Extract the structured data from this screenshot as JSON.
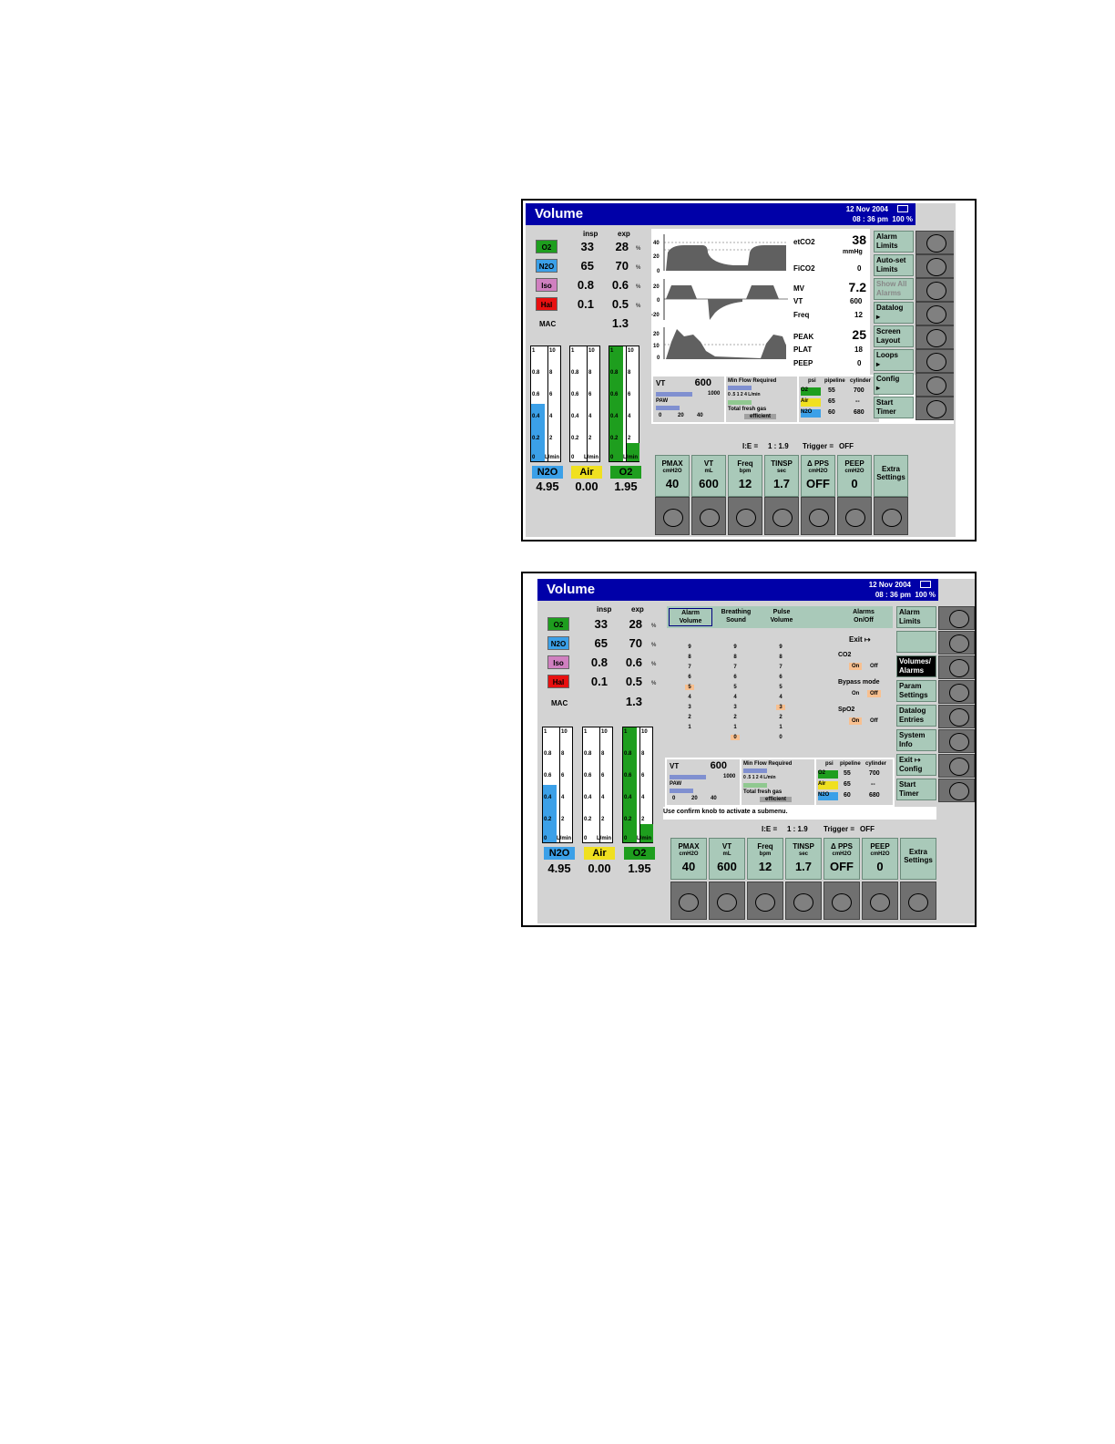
{
  "screen": {
    "title": "Volume",
    "date": "12  Nov  2004",
    "time": "08 : 36  pm",
    "battery": "100 %"
  },
  "gases": {
    "insp_header": "insp",
    "exp_header": "exp",
    "rows": [
      {
        "label": "O2",
        "insp": "33",
        "exp": "28",
        "unit": "%",
        "color": "#1e9e1e"
      },
      {
        "label": "N2O",
        "insp": "65",
        "exp": "70",
        "unit": "%",
        "color": "#3ba0e8"
      },
      {
        "label": "Iso",
        "insp": "0.8",
        "exp": "0.6",
        "unit": "%",
        "color": "#d080c0"
      },
      {
        "label": "Hal",
        "insp": "0.1",
        "exp": "0.5",
        "unit": "%",
        "color": "#e81010"
      }
    ],
    "mac_label": "MAC",
    "mac_value": "1.3"
  },
  "flowmeters": [
    {
      "name": "N2O",
      "flow": "4.95",
      "fill": 0.5,
      "color": "#3ba0e8",
      "label_color": "#3ba0e8"
    },
    {
      "name": "Air",
      "flow": "0.00",
      "fill": 0.0,
      "color": "#ffffff",
      "label_color": "#f0e020"
    },
    {
      "name": "O2",
      "flow": "1.95",
      "fill": 1.0,
      "color": "#1e9e1e",
      "label_color": "#1e9e1e"
    }
  ],
  "flow_scale_left": [
    "1",
    "0.8",
    "0.6",
    "0.4",
    "0.2",
    "0"
  ],
  "flow_scale_right": [
    "10",
    "8",
    "6",
    "4",
    "2",
    "L/min"
  ],
  "waveforms": {
    "co2_ticks": [
      "40",
      "20",
      "0"
    ],
    "flow_ticks": [
      "20",
      "0",
      "-20"
    ],
    "paw_ticks": [
      "20",
      "10",
      "0"
    ]
  },
  "vitals": {
    "etco2_label": "etCO2",
    "etco2_value": "38",
    "etco2_unit": "mmHg",
    "fico2_label": "FiCO2",
    "fico2_value": "0",
    "mv_label": "MV",
    "mv_value": "7.2",
    "vt_label": "VT",
    "vt_value": "600",
    "freq_label": "Freq",
    "freq_value": "12",
    "peak_label": "PEAK",
    "peak_value": "25",
    "plat_label": "PLAT",
    "plat_value": "18",
    "peep_label": "PEEP",
    "peep_value": "0"
  },
  "vt_box": {
    "label": "VT",
    "value": "600",
    "max": "1000",
    "paw_label": "PAW",
    "paw_ticks": [
      "0",
      "20",
      "40"
    ]
  },
  "minflow": {
    "label": "Min Flow Required",
    "ticks": "0   .5   1   2   4 L/min",
    "fresh_label": "Total fresh gas",
    "status": "efficient"
  },
  "supply": {
    "headers": [
      "psi",
      "pipeline",
      "cylinder"
    ],
    "rows": [
      {
        "gas": "O2",
        "pipeline": "55",
        "cylinder": "700",
        "color": "#1e9e1e"
      },
      {
        "gas": "Air",
        "pipeline": "65",
        "cylinder": "--",
        "color": "#f0e020"
      },
      {
        "gas": "N2O",
        "pipeline": "60",
        "cylinder": "680",
        "color": "#3ba0e8"
      }
    ]
  },
  "side_menu_1": [
    {
      "label": "Alarm\nLimits",
      "state": "normal"
    },
    {
      "label": "Auto-set\nLimits",
      "state": "normal"
    },
    {
      "label": "Show All\nAlarms",
      "state": "dim"
    },
    {
      "label": "Datalog\n▸",
      "state": "normal"
    },
    {
      "label": "Screen\nLayout",
      "state": "normal"
    },
    {
      "label": "Loops\n▸",
      "state": "normal"
    },
    {
      "label": "Config\n▸",
      "state": "normal"
    },
    {
      "label": "Start\nTimer",
      "state": "normal"
    }
  ],
  "side_menu_2": [
    {
      "label": "Alarm\nLimits",
      "state": "normal"
    },
    {
      "label": "",
      "state": "normal"
    },
    {
      "label": "Volumes/\nAlarms",
      "state": "sel"
    },
    {
      "label": "Param\nSettings",
      "state": "normal"
    },
    {
      "label": "Datalog\nEntries",
      "state": "normal"
    },
    {
      "label": "System\nInfo",
      "state": "normal"
    },
    {
      "label": "Exit  ↦\nConfig",
      "state": "normal"
    },
    {
      "label": "Start\nTimer",
      "state": "normal"
    }
  ],
  "ventilator": {
    "ie_label": "I:E =",
    "ie_value": "1 : 1.9",
    "trigger_label": "Trigger =",
    "trigger_value": "OFF",
    "settings": [
      {
        "name": "PMAX",
        "unit": "cmH2O",
        "value": "40"
      },
      {
        "name": "VT",
        "unit": "mL",
        "value": "600"
      },
      {
        "name": "Freq",
        "unit": "bpm",
        "value": "12"
      },
      {
        "name": "TINSP",
        "unit": "sec",
        "value": "1.7"
      },
      {
        "name": "Δ PPS",
        "unit": "cmH2O",
        "value": "OFF"
      },
      {
        "name": "PEEP",
        "unit": "cmH2O",
        "value": "0"
      },
      {
        "name": "Extra\nSettings",
        "unit": "",
        "value": ""
      }
    ]
  },
  "alarm_panel": {
    "tabs": [
      "Alarm\nVolume",
      "Breathing\nSound",
      "Pulse\nVolume",
      "Alarms\nOn/Off"
    ],
    "exit_label": "Exit ↦",
    "columns": [
      {
        "values": [
          "9",
          "8",
          "7",
          "6",
          "5",
          "4",
          "3",
          "2",
          "1"
        ],
        "selected": "5"
      },
      {
        "values": [
          "9",
          "8",
          "7",
          "6",
          "5",
          "4",
          "3",
          "2",
          "1",
          "0"
        ],
        "selected": "0"
      },
      {
        "values": [
          "9",
          "8",
          "7",
          "6",
          "5",
          "4",
          "3",
          "2",
          "1",
          "0"
        ],
        "selected": "3"
      }
    ],
    "co2_label": "CO2",
    "bypass_label": "Bypass mode",
    "spo2_label": "SpO2",
    "on": "On",
    "off": "Off",
    "hint": "Use confirm knob to activate a submenu."
  }
}
